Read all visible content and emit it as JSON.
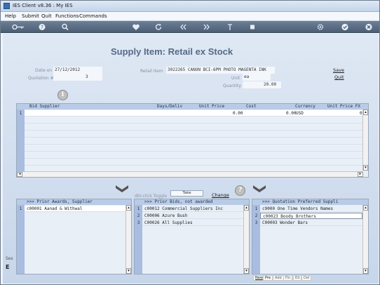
{
  "window": {
    "title": "IES Client v8.36 : My IES"
  },
  "menu": [
    "Help",
    "Submit",
    "Quit",
    "Functions",
    "Commands"
  ],
  "toolbar_icons": [
    "key-icon",
    "help-icon",
    "search-icon",
    "heart-icon",
    "refresh-icon",
    "rewind-icon",
    "fast-forward-icon",
    "upload-icon",
    "stop-icon",
    "gear-icon",
    "check-icon",
    "close-icon"
  ],
  "page": {
    "title": "Supply Item: Retail ex Stock",
    "date_label": "Date-on",
    "date_value": "27/12/2012",
    "quotation_label": "Quotation #",
    "quotation_value": "3",
    "retail_item_label": "Retail Item",
    "retail_item_value": "3022265 CANON BCI-6PM PHOTO MAGENTA INK",
    "unit_label": "Unit",
    "unit_value": "ea",
    "quantity_label": "Quantity",
    "quantity_value": "20.00",
    "save_label": "Save",
    "quit_label": "Quit",
    "info_glyph": "i",
    "help_glyph": "?"
  },
  "bid_grid": {
    "headers": [
      "Bid Supplier",
      "Days/Deliv",
      "Unit Price",
      "Cost",
      "Currency",
      "Unit Price FX"
    ],
    "rows": [
      {
        "num": "1",
        "supplier": "",
        "days": "",
        "unit_price": "0.00",
        "cost": "0.00",
        "currency": "USD",
        "unit_price_fx": "0"
      }
    ]
  },
  "toggle": {
    "hint": "dbl-click Toggle",
    "take_label": "Take",
    "change_label": "Change"
  },
  "prior_awards": {
    "header": ">>> Prior Awards, Supplier",
    "rows": [
      {
        "num": "1",
        "text": "c00001 Aanad & Withwal"
      }
    ]
  },
  "prior_bids": {
    "header": ">>> Prior Bids, not awarded",
    "rows": [
      {
        "num": "1",
        "text": "c00012 Commercial Suppliers Inc"
      },
      {
        "num": "2",
        "text": "C00006 Azure Bush"
      },
      {
        "num": "3",
        "text": "C00026 All Supplies"
      }
    ]
  },
  "preferred": {
    "header": ">>> Quotation Preferred Suppli",
    "rows": [
      {
        "num": "1",
        "text": "c9000 One Time Vendors Names"
      },
      {
        "num": "2",
        "text": "c00023 Boody Brothers"
      },
      {
        "num": "3",
        "text": "C00003 Wonder Bars"
      }
    ]
  },
  "bottom_tabs": [
    "New",
    "Pre",
    "Add",
    "Fin",
    "Ed",
    "Del"
  ],
  "side_tags": [
    "Ses",
    "E"
  ],
  "scroll_glyphs": {
    "up": "▲",
    "down": "▼",
    "left": "◄",
    "right": "►"
  }
}
